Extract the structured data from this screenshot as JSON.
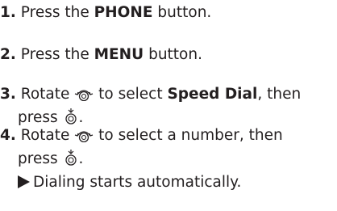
{
  "steps": [
    {
      "number": "1.",
      "before": "Press the",
      "bold": "PHONE",
      "after": "button."
    },
    {
      "number": "2.",
      "before": "Press the",
      "bold": "MENU",
      "after": "button."
    },
    {
      "number": "3.",
      "before": "Rotate",
      "icon_rotate": "rotate-knob-icon",
      "middle": "to select",
      "bold": "Speed Dial",
      "after": ", then",
      "line2_before": "press",
      "icon_press": "press-knob-icon",
      "line2_after": "."
    },
    {
      "number": "4.",
      "before": "Rotate",
      "icon_rotate": "rotate-knob-icon",
      "middle": "to select a number, then",
      "line2_before": "press",
      "icon_press": "press-knob-icon",
      "line2_after": ".",
      "result_icon": "right-triangle-arrow-icon",
      "result": "Dialing starts automatically."
    }
  ]
}
